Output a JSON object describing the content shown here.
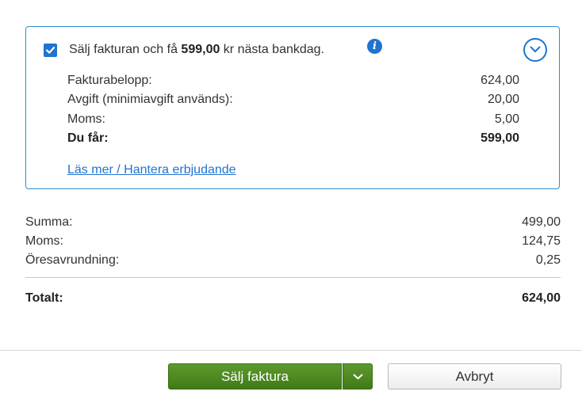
{
  "offer": {
    "headline_prefix": "Sälj fakturan och få ",
    "headline_amount": "599,00",
    "headline_suffix": " kr nästa bankdag.",
    "checked": true,
    "details": [
      {
        "label": "Fakturabelopp:",
        "value": "624,00"
      },
      {
        "label": "Avgift (minimiavgift används):",
        "value": "20,00"
      },
      {
        "label": "Moms:",
        "value": "5,00"
      },
      {
        "label": "Du får:",
        "value": "599,00"
      }
    ],
    "link": "Läs mer / Hantera erbjudande"
  },
  "summary": {
    "rows": [
      {
        "label": "Summa:",
        "value": "499,00"
      },
      {
        "label": "Moms:",
        "value": "124,75"
      },
      {
        "label": "Öresavrundning:",
        "value": "0,25"
      }
    ],
    "total": {
      "label": "Totalt:",
      "value": "624,00"
    }
  },
  "buttons": {
    "primary": "Sälj faktura",
    "cancel": "Avbryt"
  },
  "icons": {
    "info": "info-icon",
    "collapse": "chevron-down-icon",
    "dropdown": "chevron-down-icon",
    "check": "checkmark-icon"
  },
  "colors": {
    "accent": "#1f74d0",
    "primary_button": "#4a8520"
  }
}
